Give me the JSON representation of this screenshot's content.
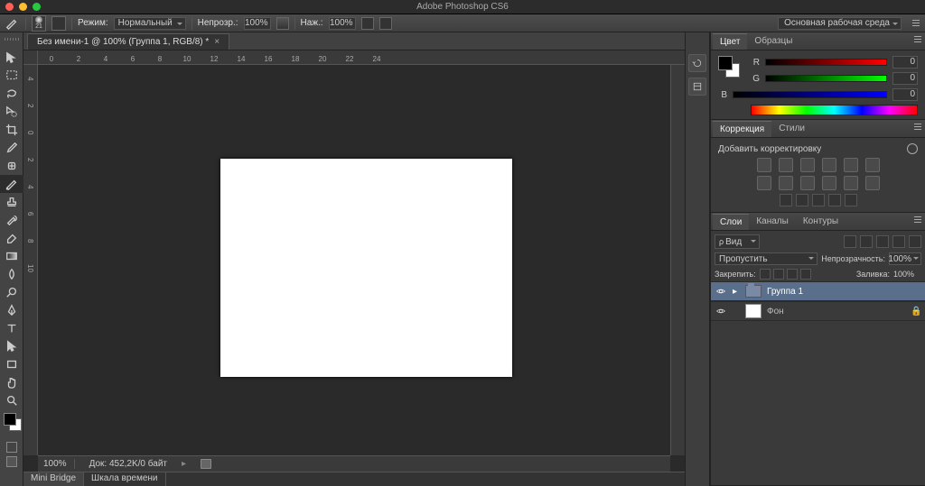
{
  "app": {
    "title": "Adobe Photoshop CS6"
  },
  "optbar": {
    "brush_size": "21",
    "mode_label": "Режим:",
    "mode_value": "Нормальный",
    "opacity_label": "Непрозр.:",
    "opacity_value": "100%",
    "flow_label": "Наж.:",
    "flow_value": "100%",
    "workspace": "Основная рабочая среда"
  },
  "tab": {
    "title": "Без имени-1 @ 100% (Группа 1, RGB/8) *"
  },
  "ruler_h": [
    "0",
    "2",
    "4",
    "6",
    "8",
    "10",
    "12",
    "14",
    "16",
    "18",
    "20",
    "22",
    "24"
  ],
  "ruler_v": [
    "4",
    "2",
    "0",
    "2",
    "4",
    "6",
    "8",
    "10"
  ],
  "status": {
    "zoom": "100%",
    "doc": "Док: 452,2K/0 байт"
  },
  "bottom_tabs": {
    "a": "Mini Bridge",
    "b": "Шкала времени"
  },
  "color_panel": {
    "tab_color": "Цвет",
    "tab_swatches": "Образцы",
    "r_label": "R",
    "r_value": "0",
    "g_label": "G",
    "g_value": "0",
    "b_label": "B",
    "b_value": "0"
  },
  "adj_panel": {
    "tab_adjustments": "Коррекция",
    "tab_styles": "Стили",
    "add_label": "Добавить корректировку"
  },
  "layers_panel": {
    "tab_layers": "Слои",
    "tab_channels": "Каналы",
    "tab_paths": "Контуры",
    "kind_icon": "ρ",
    "kind_label": "Вид",
    "blend_mode": "Пропустить",
    "opacity_label": "Непрозрачность:",
    "opacity_value": "100%",
    "lock_label": "Закрепить:",
    "fill_label": "Заливка:",
    "fill_value": "100%",
    "group_name": "Группа 1",
    "bg_name": "Фон"
  }
}
